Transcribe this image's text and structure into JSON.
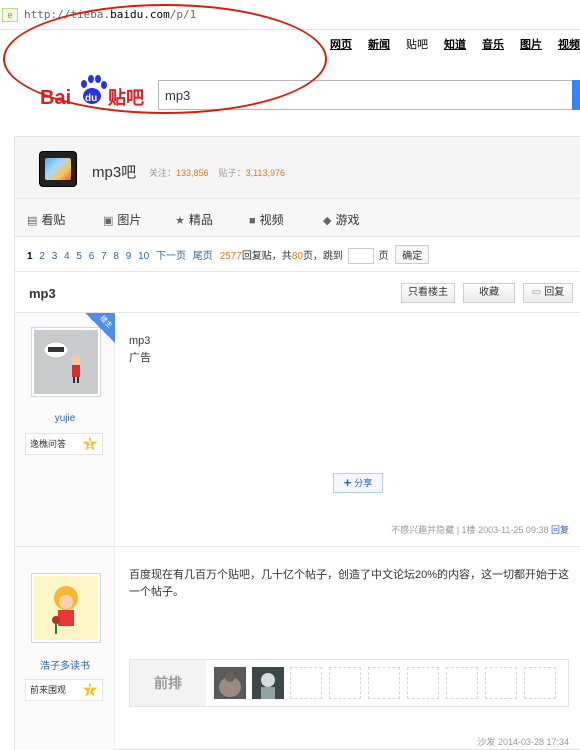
{
  "browser": {
    "url_prefix": "http://",
    "url_mid": "tieba.",
    "url_domain": "baidu.com",
    "url_path": "/p/1",
    "icon_label": "e"
  },
  "topnav": [
    "网页",
    "新闻",
    "贴吧",
    "知道",
    "音乐",
    "图片",
    "视频"
  ],
  "topnav_current_index": 2,
  "logo": {
    "text_bai": "Bai",
    "text_du": "du",
    "text_tieba": "贴吧"
  },
  "search": {
    "value": "mp3"
  },
  "forum": {
    "name": "mp3吧",
    "followers_label": "关注：",
    "followers": "133,856",
    "posts_label": "贴子：",
    "posts": "3,113,976"
  },
  "tabs": [
    {
      "icon": "list-icon",
      "label": "看贴",
      "glyph": "▤"
    },
    {
      "icon": "image-icon",
      "label": "图片",
      "glyph": "▣"
    },
    {
      "icon": "star-icon",
      "label": "精品",
      "glyph": "★"
    },
    {
      "icon": "video-icon",
      "label": "视频",
      "glyph": "■"
    },
    {
      "icon": "gamepad-icon",
      "label": "游戏",
      "glyph": "◆"
    }
  ],
  "pager": {
    "current": "1",
    "pages": [
      "2",
      "3",
      "4",
      "5",
      "6",
      "7",
      "8",
      "9",
      "10"
    ],
    "next": "下一页",
    "last": "尾页",
    "reply_count": "2577",
    "reply_text": "回复贴，共",
    "page_count": "80",
    "page_text": "页，跳到",
    "unit": "页",
    "confirm": "确定"
  },
  "thread": {
    "title": "mp3",
    "only_op": "只看楼主",
    "favorite": "收藏",
    "reply": "回复"
  },
  "posts": [
    {
      "corner_badge": "楼主",
      "username": "yujie",
      "badge_text": "逸樵问答",
      "level": "1",
      "content_lines": [
        "mp3",
        "广告"
      ],
      "share_label": "分享",
      "meta_hide": "不感兴趣并隐藏",
      "floor": "1楼",
      "time": "2003-11-25 09:38",
      "reply_link": "回复"
    },
    {
      "username": "浩子多读书",
      "badge_text": "前来围观",
      "level": "7",
      "content": "百度现在有几百万个贴吧，几十亿个帖子，创造了中文论坛20%的内容，这一切都开始于这一个帖子。",
      "front_row_label": "前排",
      "meta_prefix": "沙发",
      "time": "2014-03-28 17:34"
    }
  ],
  "colors": {
    "link": "#2d64b3",
    "highlight": "#e07a1c",
    "annotation": "#d81e06",
    "search_button": "#3385ff",
    "logo_red": "#de1f25",
    "logo_blue": "#2932e1"
  }
}
